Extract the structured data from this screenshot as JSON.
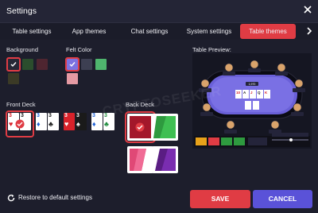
{
  "window": {
    "title": "Settings"
  },
  "tabs": [
    {
      "label": "Table settings",
      "active": false
    },
    {
      "label": "App themes",
      "active": false
    },
    {
      "label": "Chat settings",
      "active": false
    },
    {
      "label": "System settings",
      "active": false
    },
    {
      "label": "Table themes",
      "active": true
    }
  ],
  "background": {
    "label": "Background",
    "swatches": [
      "#262836",
      "#2b4d2d",
      "#4e2530",
      "#3b3a26"
    ],
    "selected_index": 0
  },
  "felt": {
    "label": "Felt Color",
    "swatches": [
      "#7c72e0",
      "#3d3f52",
      "#4fb56e",
      "#e59aa3"
    ],
    "selected_index": 0
  },
  "front_deck": {
    "label": "Front Deck",
    "rank": "3",
    "decks": [
      {
        "suits": [
          "♥",
          "♠"
        ],
        "colors": [
          "#d8222a",
          "#1a1a1a"
        ]
      },
      {
        "suits": [
          "♦",
          "♣"
        ],
        "colors": [
          "#1f62d6",
          "#1a1a1a"
        ]
      },
      {
        "suits": [
          "♥",
          "♠"
        ],
        "colors": [
          "#d8222a",
          "#1a1a1a"
        ],
        "tinted": true
      },
      {
        "suits": [
          "♦",
          "♣"
        ],
        "colors": [
          "#1f62d6",
          "#1a8a3a"
        ]
      }
    ],
    "selected_index": 0
  },
  "back_deck": {
    "label": "Back Deck",
    "selected_index": 0
  },
  "preview": {
    "label": "Table Preview:",
    "community_cards": [
      "10",
      "A",
      "J",
      "Q",
      "K"
    ],
    "pot": "1,970"
  },
  "watermark": "CRYPTOSEEKER",
  "footer": {
    "reset": "Restore to default settings",
    "save": "SAVE",
    "cancel": "CANCEL"
  },
  "colors": {
    "accent": "#e03c44",
    "secondary": "#5a52d8",
    "felt": "#6a60d8"
  }
}
